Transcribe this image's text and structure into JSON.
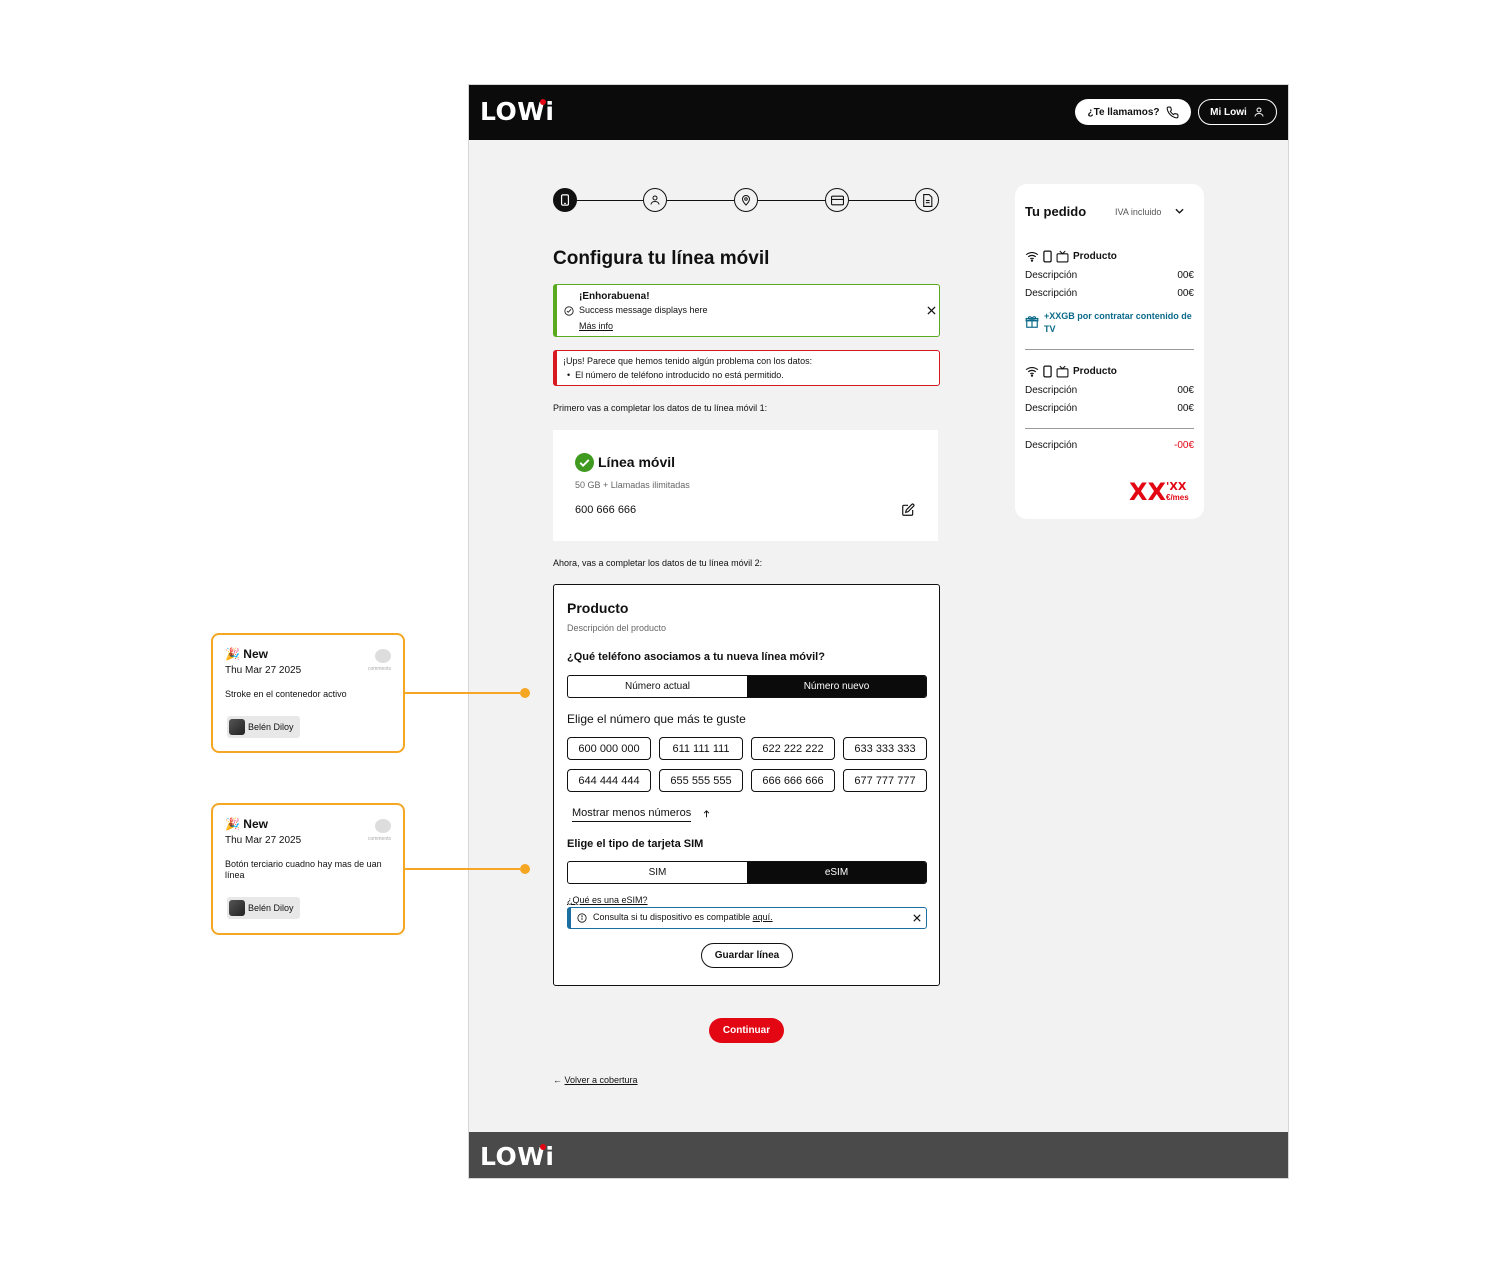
{
  "header": {
    "logo": "LOWi",
    "call_button": "¿Te llamamos?",
    "account_button": "Mi Lowi"
  },
  "stepper": {
    "steps": [
      "phone-icon",
      "user-icon",
      "location-icon",
      "card-icon",
      "document-icon"
    ],
    "active_index": 0
  },
  "main": {
    "title": "Configura tu línea móvil",
    "success_alert": {
      "title": "¡Enhorabuena!",
      "message": "Success message displays here",
      "link": "Más info"
    },
    "error_alert": {
      "title": "¡Ups! Parece que hemos tenido algún problema con los datos:",
      "item": "El número de teléfono introducido no está permitido."
    },
    "intro_line1": "Primero vas a completar los datos de tu línea móvil 1:",
    "line1_card": {
      "title": "Línea móvil",
      "subtitle": "50 GB + Llamadas ilimitadas",
      "number": "600 666 666"
    },
    "intro_line2": "Ahora, vas a completar los datos de tu línea móvil 2:",
    "line2_card": {
      "title": "Producto",
      "description": "Descripción del producto",
      "question": "¿Qué teléfono asociamos a tu nueva línea móvil?",
      "phone_toggle": [
        "Número actual",
        "Número nuevo"
      ],
      "phone_toggle_selected": 1,
      "choose_number_label": "Elige el número que más te guste",
      "numbers": [
        "600 000 000",
        "611 111 111",
        "622 222 222",
        "633 333 333",
        "644 444 444",
        "655 555 555",
        "666 666 666",
        "677 777 777"
      ],
      "show_less": "Mostrar menos números",
      "sim_label": "Elige el tipo de tarjeta SIM",
      "sim_toggle": [
        "SIM",
        "eSIM"
      ],
      "sim_toggle_selected": 1,
      "esim_link": "¿Qué es una eSIM?",
      "esim_info": "Consulta si tu dispositivo es compatible ",
      "esim_info_link": "aquí.",
      "save_button": "Guardar línea"
    },
    "continue_button": "Continuar",
    "back_link": "Volver a cobertura"
  },
  "order": {
    "title": "Tu pedido",
    "vat_label": "IVA incluido",
    "product1": {
      "name": "Producto",
      "rows": [
        {
          "label": "Descripción",
          "value": "00€"
        },
        {
          "label": "Descripción",
          "value": "00€"
        }
      ],
      "promo": "+XXGB por contratar contenido de TV"
    },
    "product2": {
      "name": "Producto",
      "rows": [
        {
          "label": "Descripción",
          "value": "00€"
        },
        {
          "label": "Descripción",
          "value": "00€"
        }
      ]
    },
    "discount": {
      "label": "Descripción",
      "value": "-00€"
    },
    "price_main": "XX",
    "price_decimals": "'XX",
    "price_unit": "€/mes"
  },
  "annotations": [
    {
      "head": "New",
      "date": "Thu Mar 27 2025",
      "body": "Stroke en el contenedor activo",
      "author": "Belén Diloy",
      "comments_label": "comments"
    },
    {
      "head": "New",
      "date": "Thu Mar 27 2025",
      "body": "Botón terciario cuadno hay mas de uan línea",
      "author": "Belén Diloy",
      "comments_label": "comments"
    }
  ],
  "colors": {
    "brand_red": "#e30613",
    "success_green": "#5aaa1f",
    "error_red": "#d71920",
    "info_blue": "#1a6fa0",
    "promo_teal": "#0a6a8a",
    "annotation_orange": "#f5a623"
  }
}
